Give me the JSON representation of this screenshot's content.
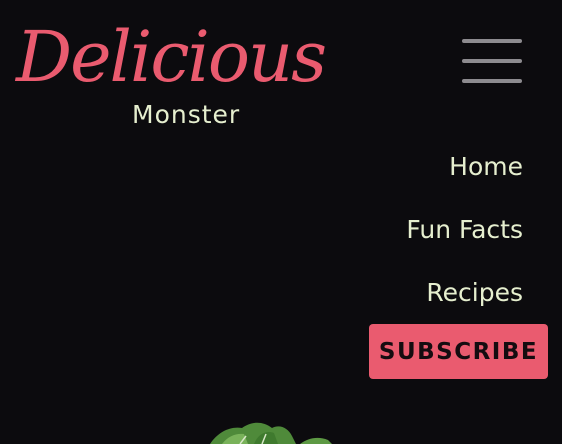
{
  "logo": {
    "title": "Delicious",
    "subtitle": "Monster"
  },
  "menu_button": {
    "icon": "hamburger-menu-icon"
  },
  "nav": {
    "items": [
      {
        "label": "Home"
      },
      {
        "label": "Fun Facts"
      },
      {
        "label": "Recipes"
      }
    ]
  },
  "subscribe": {
    "label": "SUBSCRIBE"
  },
  "colors": {
    "background": "#0c0b0e",
    "accent": "#ea5b6f",
    "text": "#e6efcf",
    "menu_icon": "#8d8b8f"
  }
}
